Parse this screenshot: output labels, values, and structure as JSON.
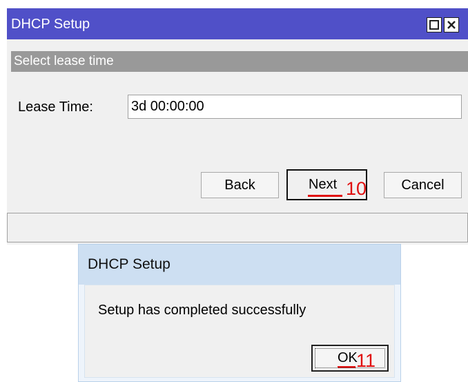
{
  "lease_window": {
    "title": "DHCP Setup",
    "title_bar_color": "#5050c8",
    "maximize_icon": "maximize-icon",
    "close_icon": "close-icon",
    "section_header": "Select lease time",
    "lease_time_label": "Lease Time:",
    "lease_time_value": "3d 00:00:00",
    "buttons": {
      "back": "Back",
      "next": "Next",
      "cancel": "Cancel"
    },
    "step_marker": "10"
  },
  "success_dialog": {
    "title": "DHCP Setup",
    "message": "Setup has completed successfully",
    "ok_label": "OK",
    "step_marker": "11"
  },
  "annotation_color": "#e01010"
}
